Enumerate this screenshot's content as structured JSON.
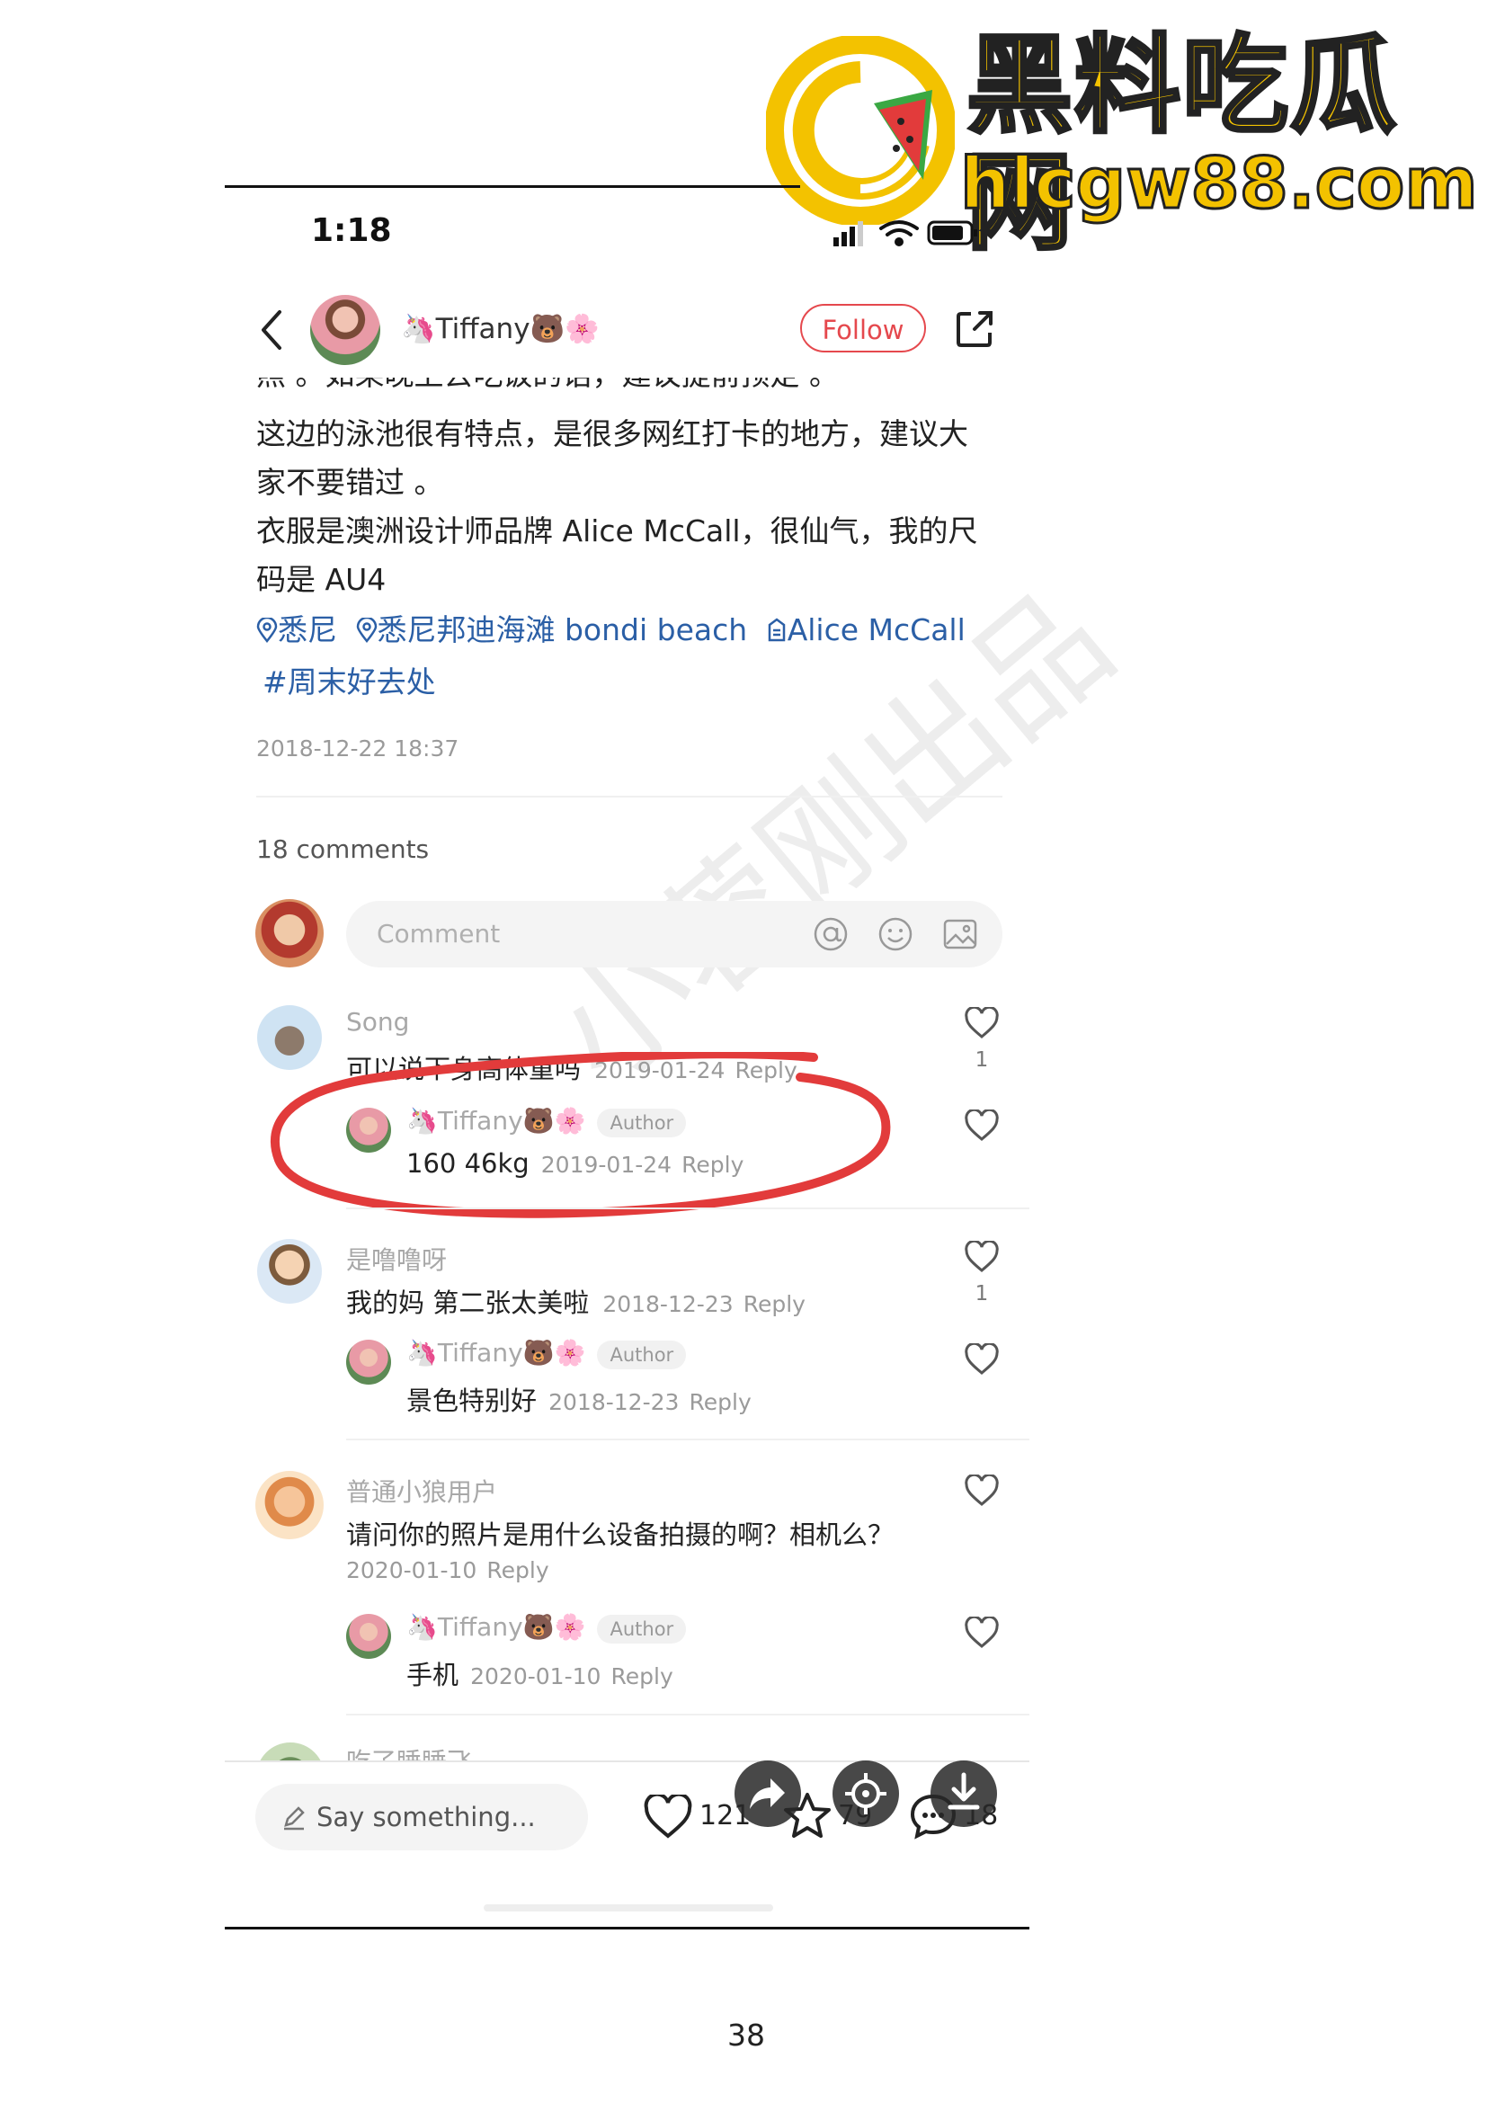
{
  "watermark": {
    "title": "黑料吃瓜网",
    "domain": "hlcgw88.com",
    "stamp": "小蓉刚出品",
    "colors": {
      "yellow": "#f3c200",
      "red": "#e23b3b",
      "green": "#3aa843"
    }
  },
  "status_bar": {
    "time": "1:18"
  },
  "header": {
    "back_icon": "chevron-left-icon",
    "username": "🦄Tiffany🐻🌸",
    "follow_label": "Follow",
    "share_icon": "share-icon"
  },
  "caption": {
    "cut_line": "照 。如果晚上去吃饭的话，建议提前预定 。",
    "line1": "这边的泳池很有特点，是很多网红打卡的地方，建议大",
    "line2": "家不要错过 。",
    "line3": "衣服是澳洲设计师品牌 Alice McCall，很仙气，我的尺",
    "line4": "码是 AU4",
    "tags": [
      {
        "icon": "location-pin-icon",
        "text": "悉尼"
      },
      {
        "icon": "location-pin-icon",
        "text": "悉尼邦迪海滩 bondi beach"
      },
      {
        "icon": "brand-tag-icon",
        "text": "Alice McCall"
      }
    ],
    "hashtag": "#周末好去处",
    "timestamp": "2018-12-22 18:37"
  },
  "comments_section": {
    "count_label": "18 comments",
    "input_placeholder": "Comment",
    "comments": [
      {
        "user": "Song",
        "text": "可以说下身高体重吗",
        "date": "2019-01-24",
        "reply": "Reply",
        "likes": "1",
        "reply_item": {
          "user": "🦄Tiffany🐻🌸",
          "badge": "Author",
          "text": "160 46kg",
          "date": "2019-01-24",
          "reply": "Reply"
        }
      },
      {
        "user": "是噜噜呀",
        "text": "我的妈 第二张太美啦",
        "date": "2018-12-23",
        "reply": "Reply",
        "likes": "1",
        "reply_item": {
          "user": "🦄Tiffany🐻🌸",
          "badge": "Author",
          "text": "景色特别好",
          "date": "2018-12-23",
          "reply": "Reply"
        }
      },
      {
        "user": "普通小狼用户",
        "text": "请问你的照片是用什么设备拍摄的啊？相机么？",
        "date": "2020-01-10",
        "reply": "Reply",
        "likes": "",
        "reply_item": {
          "user": "🦄Tiffany🐻🌸",
          "badge": "Author",
          "text": "手机",
          "date": "2020-01-10",
          "reply": "Reply"
        }
      }
    ],
    "partial_user": "吃了睡睡飞"
  },
  "bottom_bar": {
    "placeholder": "Say something...",
    "likes": "121",
    "stars": "79",
    "comments": "18"
  },
  "page_number": "38"
}
